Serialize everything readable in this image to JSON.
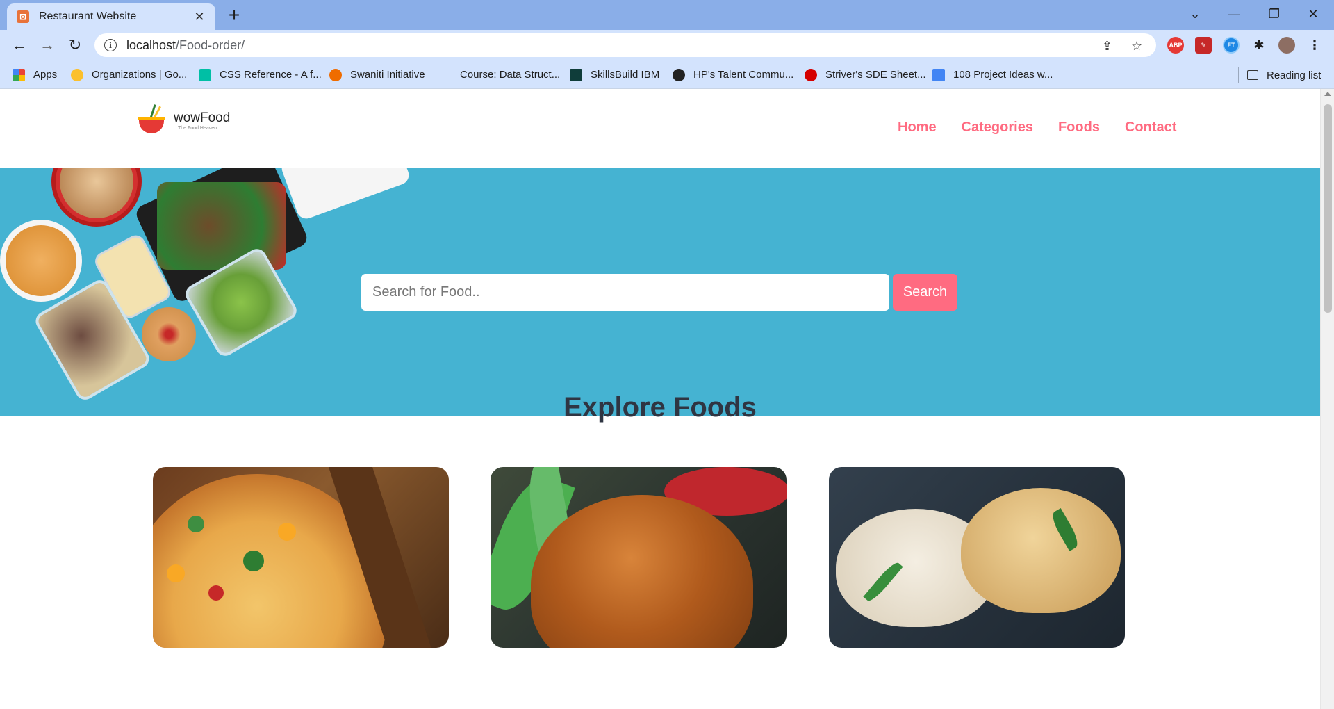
{
  "browser": {
    "tab_title": "Restaurant Website",
    "tab_close": "✕",
    "new_tab": "+",
    "url_host": "localhost",
    "url_path": "/Food-order/",
    "window": {
      "minimize": "—",
      "restore": "❐",
      "close": "✕",
      "tab_search": "⌄"
    },
    "extensions": [
      "ABP",
      "FT"
    ],
    "bookmarks": [
      {
        "label": "Apps",
        "icon": "apps-grid-icon"
      },
      {
        "label": "Organizations | Go...",
        "icon": "sun-icon"
      },
      {
        "label": "CSS Reference - A f...",
        "icon": "css-icon"
      },
      {
        "label": "Swaniti Initiative",
        "icon": "swaniti-icon"
      },
      {
        "label": "Course: Data Struct...",
        "icon": "course-icon"
      },
      {
        "label": "SkillsBuild IBM",
        "icon": "skillsbuild-icon"
      },
      {
        "label": "HP's Talent Commu...",
        "icon": "globe-icon"
      },
      {
        "label": "Striver's SDE Sheet...",
        "icon": "tuf-icon"
      },
      {
        "label": "108 Project Ideas w...",
        "icon": "doc-icon"
      }
    ],
    "reading_list": "Reading list"
  },
  "site": {
    "logo": {
      "name": "wowFood",
      "tagline": "The Food Heaven"
    },
    "nav": [
      "Home",
      "Categories",
      "Foods",
      "Contact"
    ],
    "search": {
      "placeholder": "Search for Food..",
      "button": "Search"
    },
    "section_title": "Explore Foods"
  },
  "colors": {
    "accent": "#ff6b81",
    "hero_bg": "#45b3d2",
    "heading": "#2f3542"
  }
}
